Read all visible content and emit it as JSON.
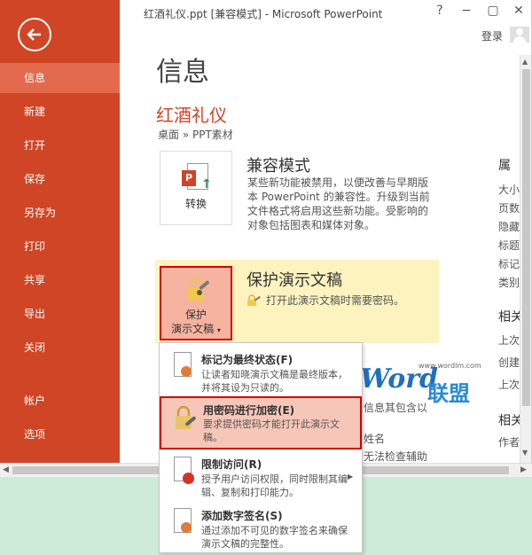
{
  "window": {
    "title": "红酒礼仪.ppt [兼容模式] - Microsoft PowerPoint",
    "controls": [
      "?",
      "−",
      "▢",
      "✕"
    ],
    "login": "登录"
  },
  "sidebar": {
    "items": [
      {
        "label": "信息"
      },
      {
        "label": "新建"
      },
      {
        "label": "打开"
      },
      {
        "label": "保存"
      },
      {
        "label": "另存为"
      },
      {
        "label": "打印"
      },
      {
        "label": "共享"
      },
      {
        "label": "导出"
      },
      {
        "label": "关闭"
      },
      {
        "label": "帐户"
      },
      {
        "label": "选项"
      }
    ],
    "active_index": 0
  },
  "main": {
    "page_title": "信息",
    "doc_title": "红酒礼仪",
    "path": "桌面 » PPT素材",
    "compat": {
      "button_label": "转换",
      "heading": "兼容模式",
      "lines": [
        "某些新功能被禁用，以便改善与早期版",
        "本 PowerPoint 的兼容性。升级到当前",
        "文件格式将启用这些新功能。受影响的",
        "对象包括图表和媒体对象。"
      ]
    },
    "protect": {
      "button_line1": "保护",
      "button_line2": "演示文稿",
      "heading": "保护演示文稿",
      "desc": "打开此演示文稿时需要密码。"
    },
    "right_panel": {
      "head1": "属",
      "props": [
        "大小",
        "页数",
        "隐藏",
        "标题",
        "标记",
        "类别"
      ],
      "head2": "相关",
      "dates": [
        "上次",
        "创建",
        "上次"
      ],
      "head3": "相关",
      "author": "作者"
    },
    "partial_texts": {
      "behind_1": "信息其包含以",
      "behind_2": "姓名",
      "behind_3": "无法检查辅助"
    }
  },
  "menu": {
    "items": [
      {
        "title": "标记为最终状态(F)",
        "desc": "让读者知晓演示文稿是最终版本，并将其设为只读的。"
      },
      {
        "title": "用密码进行加密(E)",
        "desc": "要求提供密码才能打开此演示文稿。"
      },
      {
        "title": "限制访问(R)",
        "desc": "授予用户访问权限，同时限制其编辑、复制和打印能力。"
      },
      {
        "title": "添加数字签名(S)",
        "desc": "通过添加不可见的数字签名来确保演示文稿的完整性。"
      }
    ],
    "highlight_index": 1
  },
  "watermark": {
    "word": "Word",
    "cn": "联盟",
    "url": "www.wordlm.com"
  },
  "colors": {
    "sidebar": "#d04525",
    "sidebar_active": "#e36a4c",
    "accent_red": "#d40000",
    "protect_bg": "#fdf3bf",
    "background": "#cdebd8"
  }
}
